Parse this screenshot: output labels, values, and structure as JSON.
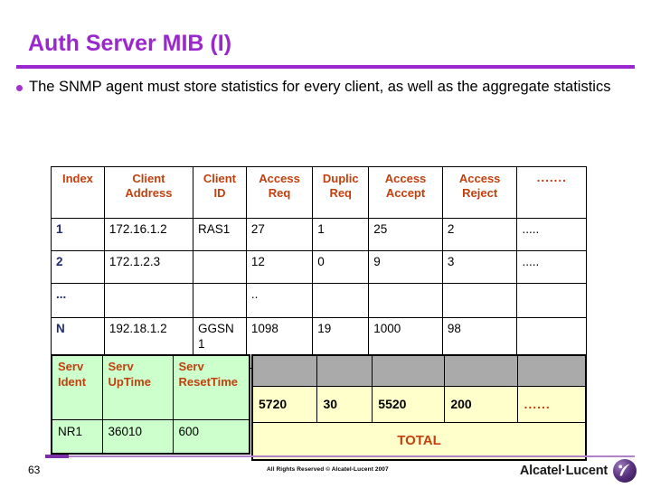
{
  "slide": {
    "title": "Auth Server MIB (I)",
    "page_number": "63",
    "copyright": "All Rights Reserved © Alcatel-Lucent 2007",
    "brand": "Alcatel·Lucent",
    "accent_color": "#9A28CC",
    "header_color": "#C1400D",
    "index_color": "#1F2B78",
    "green_fill": "#CCFFCC",
    "yellow_fill": "#FFFFCC",
    "gray_fill": "#AAAAAA"
  },
  "bullets": [
    "The SNMP agent must store statistics for every client, as well as the aggregate statistics"
  ],
  "client_table": {
    "headers": [
      "Index",
      "Client Address",
      "Client ID",
      "Access Req",
      "Duplic Req",
      "Access Accept",
      "Access Reject",
      "......."
    ],
    "rows": [
      {
        "index": "1",
        "client_address": "172.16.1.2",
        "client_id": "RAS1",
        "access_req": "27",
        "duplic_req": "1",
        "access_accept": "25",
        "access_reject": "2",
        "more": "....."
      },
      {
        "index": "2",
        "client_address": "172.1.2.3",
        "client_id": "",
        "access_req": "12",
        "duplic_req": "0",
        "access_accept": "9",
        "access_reject": "3",
        "more": "....."
      },
      {
        "index": "...",
        "client_address": "",
        "client_id": "",
        "access_req": "..",
        "duplic_req": "",
        "access_accept": "",
        "access_reject": "",
        "more": ""
      },
      {
        "index": "N",
        "client_address": "192.18.1.2",
        "client_id": "GGSN 1",
        "access_req": "1098",
        "duplic_req": "19",
        "access_accept": "1000",
        "access_reject": "98",
        "more": ""
      }
    ]
  },
  "server_table": {
    "headers": [
      "Serv Ident",
      "Serv UpTime",
      "Serv ResetTime"
    ],
    "row": {
      "serv_ident": "NR1",
      "serv_uptime": "36010",
      "serv_resettime": "600"
    }
  },
  "totals_table": {
    "values": {
      "access_req": "5720",
      "duplic_req": "30",
      "access_accept": "5520",
      "access_reject": "200",
      "more": "......"
    },
    "label": "TOTAL"
  }
}
